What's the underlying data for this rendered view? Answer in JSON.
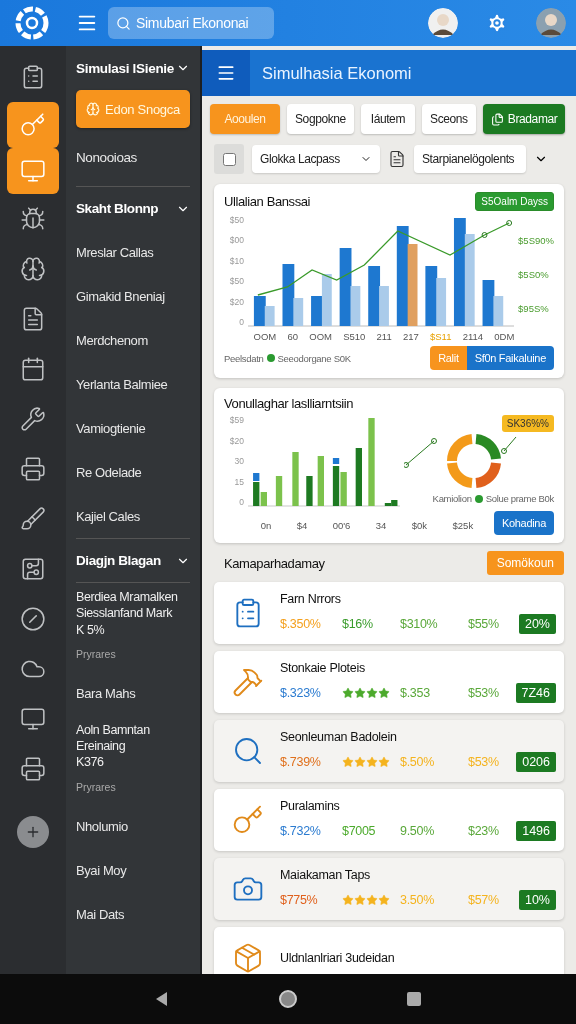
{
  "top_bar": {
    "search": {
      "value": "Simubari Ekononai"
    }
  },
  "rail_items": [
    {
      "selected": false
    },
    {
      "selected": true
    },
    {
      "selected": true
    },
    {
      "selected": false
    },
    {
      "selected": false
    },
    {
      "selected": false
    },
    {
      "selected": false
    },
    {
      "selected": false
    },
    {
      "selected": false
    },
    {
      "selected": false
    },
    {
      "selected": false
    },
    {
      "selected": false
    },
    {
      "selected": false
    },
    {
      "selected": false
    },
    {
      "selected": false
    }
  ],
  "nav": {
    "title": "Simulasi lSienie",
    "primary_button": "Edon Snogca",
    "top_item": "Nonooioas",
    "sections": [
      {
        "title": "Skaht Blonnp",
        "expanded": true,
        "items": [
          {
            "label": "Mreslar Callas"
          },
          {
            "label": "Gimakid Bneniaj"
          },
          {
            "label": "Merdchenom"
          },
          {
            "label": "Yerlanta Balmiee"
          },
          {
            "label": "Vamiogtienie"
          },
          {
            "label": "Re Odelade"
          },
          {
            "label": "Kajiel Cales"
          }
        ]
      },
      {
        "title": "Diagjn Blagan",
        "expanded": true,
        "items": [
          {
            "label": "Berdiea Mramalken\nSiesslanfand Mark\nK 5%",
            "note": "Pryrares"
          },
          {
            "label": "Bara Mahs"
          },
          {
            "label": "Aoln Bamntan\nEreinaing\nK376",
            "note": "Pryrares"
          },
          {
            "label": "Nholumio"
          },
          {
            "label": "Byai Moy"
          },
          {
            "label": "Mai Dats"
          }
        ]
      }
    ]
  },
  "header": {
    "title": "Simulhasia Ekonomi"
  },
  "tabs": [
    {
      "label": "Aooulen",
      "selected": true
    },
    {
      "label": "Sogpokne",
      "selected": false
    },
    {
      "label": "Iáutem",
      "selected": false
    },
    {
      "label": "Sceons",
      "selected": false
    }
  ],
  "action_button": {
    "label": "Bradamar"
  },
  "filters": {
    "checked": false,
    "first_select": "Glokka Lacpass",
    "second_select": "Starpianelögolents"
  },
  "chart_one": {
    "title": "Ullalian Banssai",
    "badge": "S5Oalm Dayss",
    "y_ticks": [
      "$50",
      "$00",
      "$10",
      "$50",
      "$20",
      "0"
    ],
    "right_labels": [
      "$5S90%",
      "$5S0%",
      "$95S%"
    ],
    "x_labels": [
      {
        "text": "ООМ",
        "highlight": false
      },
      {
        "text": "60",
        "highlight": false
      },
      {
        "text": "ООМ",
        "highlight": false
      },
      {
        "text": "S510",
        "highlight": false
      },
      {
        "text": "211",
        "highlight": false
      },
      {
        "text": "217",
        "highlight": false
      },
      {
        "text": "$S11",
        "highlight": true
      },
      {
        "text": "2114",
        "highlight": false
      },
      {
        "text": "0DM",
        "highlight": false
      }
    ],
    "legend_first": "Peelsdatn",
    "legend_second": "Seeodorgane S0K",
    "buttons": [
      {
        "label": "Ralit",
        "color": "#f7941d"
      },
      {
        "label": "Sf0n Faikaluine",
        "color": "#1a73c9"
      }
    ]
  },
  "chart_two": {
    "title": "Vonullaghar laslliarntsiin",
    "y_ticks": [
      "$59",
      "$20",
      "30",
      "15",
      "0"
    ],
    "x_labels": [
      "0n",
      "$4",
      "00'6",
      "34",
      "$0k",
      "$25k"
    ],
    "badge": "SK36%%",
    "legend_first": "Kamiolion",
    "legend_second": "Solue prame B0k",
    "button": "Kohadina"
  },
  "section": {
    "title": "Kamaparhadamay",
    "button": "Somökoun"
  },
  "rows": [
    {
      "title": "Farn Nrrors",
      "shaded": false,
      "values": [
        {
          "kind": "text",
          "text": "$.350%",
          "color": "#f4a01e"
        },
        {
          "kind": "text",
          "text": "$16%",
          "color": "#3a9c2c"
        },
        {
          "kind": "text",
          "text": "$310%",
          "color": "#5aa83a"
        },
        {
          "kind": "text",
          "text": "$55%",
          "color": "#5aa83a"
        }
      ],
      "badge": "20%"
    },
    {
      "title": "Stonkaie Ploteis",
      "shaded": false,
      "values": [
        {
          "kind": "text",
          "text": "$.323%",
          "color": "#2b7bd0"
        },
        {
          "kind": "stars",
          "stars": 4,
          "color": "#4caa2c"
        },
        {
          "kind": "text",
          "text": "$.353",
          "color": "#5aa83a"
        },
        {
          "kind": "text",
          "text": "$53%",
          "color": "#5aa83a"
        }
      ],
      "badge": "7Z46"
    },
    {
      "title": "Seonleuman Badolein",
      "shaded": true,
      "values": [
        {
          "kind": "text",
          "text": "$.739%",
          "color": "#e0701c"
        },
        {
          "kind": "stars",
          "stars": 4,
          "color": "#f4b31e"
        },
        {
          "kind": "text",
          "text": "$.50%",
          "color": "#f4b31e"
        },
        {
          "kind": "text",
          "text": "$53%",
          "color": "#f4b31e"
        }
      ],
      "badge": "0206"
    },
    {
      "title": "Puralamins",
      "shaded": false,
      "values": [
        {
          "kind": "text",
          "text": "$.732%",
          "color": "#2b7bd0"
        },
        {
          "kind": "text",
          "text": "$7005",
          "color": "#4caa2c"
        },
        {
          "kind": "text",
          "text": "9.50%",
          "color": "#5aa83a"
        },
        {
          "kind": "text",
          "text": "$23%",
          "color": "#5aa83a"
        }
      ],
      "badge": "1496"
    },
    {
      "title": "Maiakaman Taps",
      "shaded": true,
      "values": [
        {
          "kind": "text",
          "text": "$775%",
          "color": "#e0601c"
        },
        {
          "kind": "stars",
          "stars": 4,
          "color": "#f4b31e"
        },
        {
          "kind": "text",
          "text": "3.50%",
          "color": "#f4b31e"
        },
        {
          "kind": "text",
          "text": "$57%",
          "color": "#f4b31e"
        }
      ],
      "badge": "10%"
    },
    {
      "title": "Uldnlanlriari 3udeidan",
      "shaded": false,
      "values": [],
      "badge": ""
    }
  ]
}
